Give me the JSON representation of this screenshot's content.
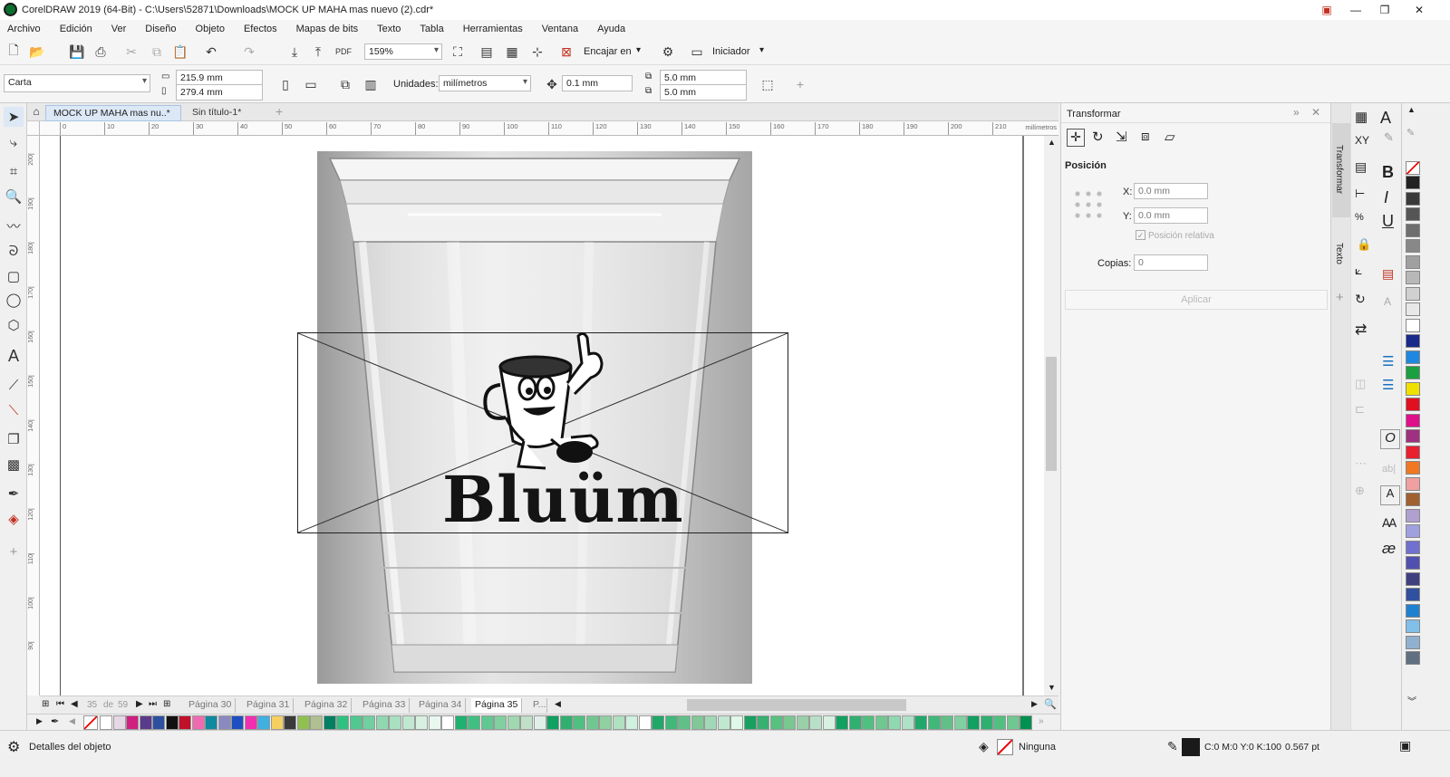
{
  "titlebar": {
    "title": "CorelDRAW 2019 (64-Bit) - C:\\Users\\52871\\Downloads\\MOCK UP MAHA mas nuevo (2).cdr*"
  },
  "menu": [
    "Archivo",
    "Edición",
    "Ver",
    "Diseño",
    "Objeto",
    "Efectos",
    "Mapas de bits",
    "Texto",
    "Tabla",
    "Herramientas",
    "Ventana",
    "Ayuda"
  ],
  "toolbar": {
    "zoom": "159%",
    "snap_label": "Encajar en",
    "launch_label": "Iniciador",
    "pdf_label": "PDF"
  },
  "propbar": {
    "page_size": "Carta",
    "width": "215.9 mm",
    "height": "279.4 mm",
    "units_label": "Unidades:",
    "units": "milímetros",
    "nudge": "0.1 mm",
    "dup_x": "5.0 mm",
    "dup_y": "5.0 mm"
  },
  "doc_tabs": [
    "MOCK UP MAHA mas nu..*",
    "Sin título-1*"
  ],
  "ruler": {
    "unit": "milímetros",
    "h_ticks": [
      "0",
      "10",
      "20",
      "30",
      "40",
      "50",
      "60",
      "70",
      "80",
      "90",
      "100",
      "110",
      "120",
      "130",
      "140",
      "150",
      "160",
      "170",
      "180",
      "190",
      "200",
      "210"
    ],
    "v_ticks": [
      "200",
      "190",
      "180",
      "170",
      "160",
      "150",
      "140",
      "130",
      "120",
      "110",
      "100",
      "90"
    ]
  },
  "artwork": {
    "brand": "Bluüm"
  },
  "pagenav": {
    "current": "35",
    "of_label": "de",
    "total": "59",
    "pages": [
      "Página 30",
      "Página 31",
      "Página 32",
      "Página 33",
      "Página 34",
      "Página 35",
      "P..."
    ]
  },
  "docker": {
    "title": "Transformar",
    "section": "Posición",
    "x_label": "X:",
    "x_value": "0.0 mm",
    "y_label": "Y:",
    "y_value": "0.0 mm",
    "relative_label": "Posición relativa",
    "copies_label": "Copias:",
    "copies_value": "0",
    "apply_label": "Aplicar",
    "strip_tabs": [
      "Transformar",
      "Texto"
    ]
  },
  "status": {
    "details": "Detalles del objeto",
    "fill_label": "Ninguna",
    "outline_color": "C:0 M:0 Y:0 K:100",
    "outline_width": "0.567 pt"
  },
  "palette_h": [
    "#ffffff",
    "#e6d7e6",
    "#d02080",
    "#5a3a8a",
    "#2c4fa0",
    "#111111",
    "#c0102a",
    "#f06ab0",
    "#0f8aa0",
    "#8a8ac0",
    "#1f4ec0",
    "#f030b0",
    "#40b0e0",
    "#f5d060",
    "#3a3a3a",
    "#90c050",
    "#b0c090",
    "#008060",
    "#30c080",
    "#50c890",
    "#70d0a0",
    "#90d8b0",
    "#a8e0c0",
    "#c0e8d0",
    "#d8f0e0",
    "#e8f8f0",
    "#ffffff",
    "#20b070",
    "#40c080",
    "#60c890",
    "#80d0a0",
    "#a0d8b0",
    "#c0e0c8",
    "#e0f0e8",
    "#10a060",
    "#30b070",
    "#50c080",
    "#70c890",
    "#90d0a0",
    "#b0e0c0",
    "#d0f0e0",
    "#ffffff",
    "#20a868",
    "#40b878",
    "#60c088",
    "#80c898",
    "#a0d8b8",
    "#c0e8d0",
    "#e0f8e8",
    "#18a060",
    "#38b070",
    "#58c080",
    "#78c890",
    "#98d0a8",
    "#b8e0c8",
    "#d8f0e0",
    "#10a060",
    "#30b070",
    "#50c080",
    "#70c890",
    "#90d8b0",
    "#b0e0c8",
    "#20a868",
    "#40b878",
    "#60c088",
    "#80d0a0",
    "#10a060",
    "#30b070",
    "#50c080",
    "#70c890",
    "#009050"
  ],
  "palette_v": [
    "#222222",
    "#3a3a3a",
    "#555555",
    "#6e6e6e",
    "#888888",
    "#a0a0a0",
    "#b8b8b8",
    "#d0d0d0",
    "#e8e8e8",
    "#ffffff",
    "#1a2a8a",
    "#1e88e0",
    "#1aa040",
    "#f0e000",
    "#e01020",
    "#e0108a",
    "#a03080",
    "#e82030",
    "#f07820",
    "#f0a0a0",
    "#a06030",
    "#b0a0d0",
    "#a0a0e0",
    "#7070d0",
    "#5050b0",
    "#404080",
    "#3050a0",
    "#2080d0",
    "#80c0e8",
    "#90b0d0",
    "#607080"
  ]
}
